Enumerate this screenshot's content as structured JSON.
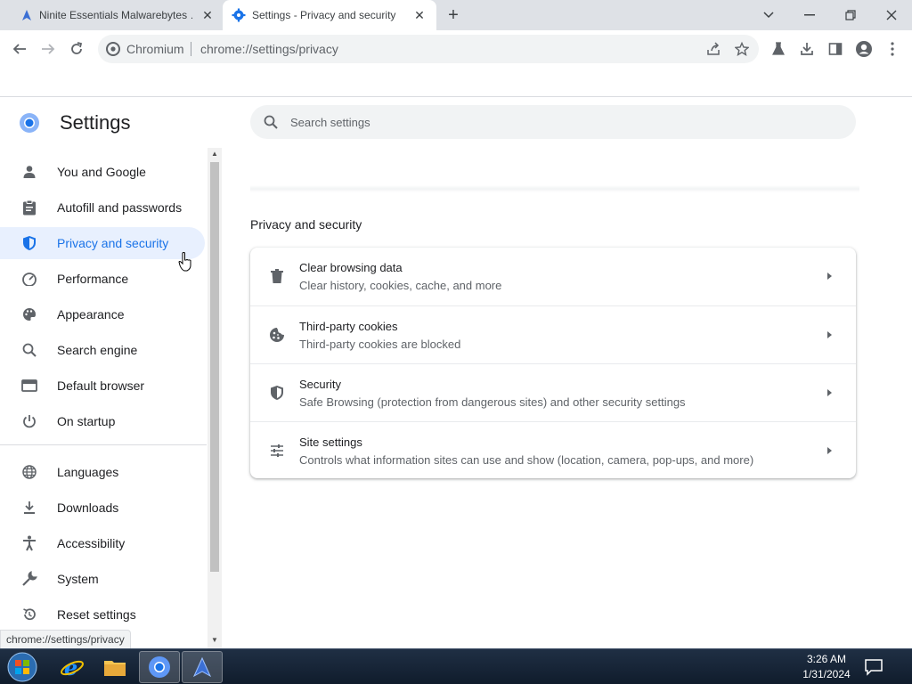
{
  "tabs": [
    {
      "title": "Ninite Essentials Malwarebytes …",
      "close_label": "✕"
    },
    {
      "title": "Settings - Privacy and security",
      "close_label": "✕"
    }
  ],
  "new_tab_label": "+",
  "window_controls": {
    "minimize": "—",
    "restore": "❐",
    "close": "✕"
  },
  "omnibox": {
    "site_label": "Chromium",
    "url": "chrome://settings/privacy"
  },
  "settings": {
    "title": "Settings",
    "search_placeholder": "Search settings"
  },
  "sidebar": {
    "items": [
      {
        "label": "You and Google",
        "icon": "person-icon"
      },
      {
        "label": "Autofill and passwords",
        "icon": "clipboard-icon"
      },
      {
        "label": "Privacy and security",
        "icon": "shield-icon",
        "active": true
      },
      {
        "label": "Performance",
        "icon": "speedometer-icon"
      },
      {
        "label": "Appearance",
        "icon": "palette-icon"
      },
      {
        "label": "Search engine",
        "icon": "search-icon"
      },
      {
        "label": "Default browser",
        "icon": "browser-icon"
      },
      {
        "label": "On startup",
        "icon": "power-icon"
      },
      {
        "label": "Languages",
        "icon": "globe-icon"
      },
      {
        "label": "Downloads",
        "icon": "download-icon"
      },
      {
        "label": "Accessibility",
        "icon": "accessibility-icon"
      },
      {
        "label": "System",
        "icon": "wrench-icon"
      },
      {
        "label": "Reset settings",
        "icon": "reset-icon"
      }
    ]
  },
  "main": {
    "section_title": "Privacy and security",
    "rows": [
      {
        "title": "Clear browsing data",
        "subtitle": "Clear history, cookies, cache, and more",
        "icon": "trash-icon"
      },
      {
        "title": "Third-party cookies",
        "subtitle": "Third-party cookies are blocked",
        "icon": "cookie-icon"
      },
      {
        "title": "Security",
        "subtitle": "Safe Browsing (protection from dangerous sites) and other security settings",
        "icon": "shield-icon"
      },
      {
        "title": "Site settings",
        "subtitle": "Controls what information sites can use and show (location, camera, pop-ups, and more)",
        "icon": "sliders-icon"
      }
    ]
  },
  "status_url": "chrome://settings/privacy",
  "taskbar": {
    "time": "3:26 AM",
    "date": "1/31/2024"
  },
  "colors": {
    "accent": "#1a73e8",
    "active_nav_bg": "#e8f0fe",
    "tabstrip": "#dee1e6"
  }
}
